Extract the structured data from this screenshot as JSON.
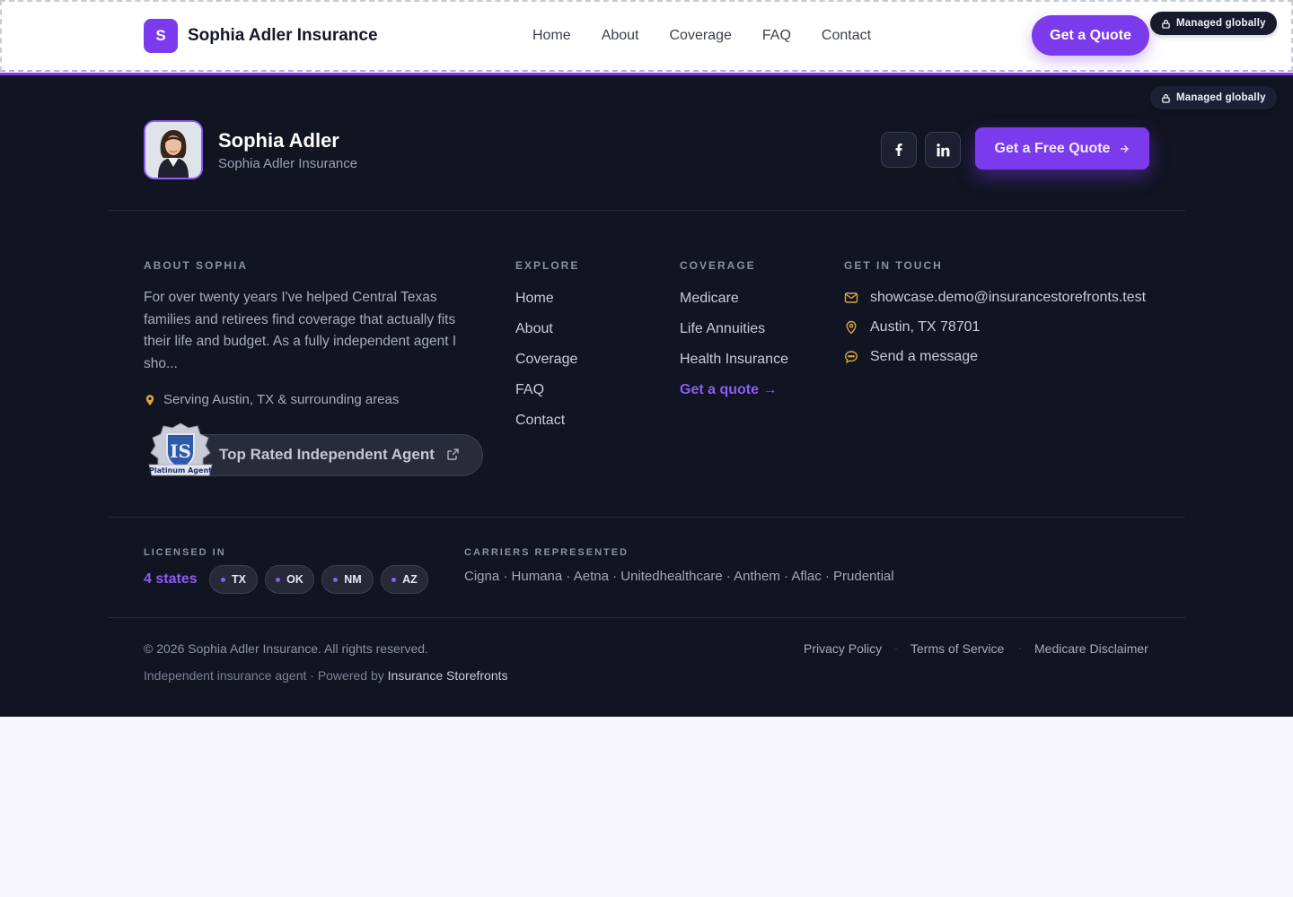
{
  "header": {
    "brand_initial": "S",
    "brand_name": "Sophia Adler Insurance",
    "nav": [
      "Home",
      "About",
      "Coverage",
      "FAQ",
      "Contact"
    ],
    "cta_label": "Get a Quote"
  },
  "badges": {
    "managed_label": "Managed globally"
  },
  "agent": {
    "name": "Sophia Adler",
    "company": "Sophia Adler Insurance",
    "cta_label": "Get a Free Quote",
    "social": [
      "facebook-icon",
      "linkedin-icon"
    ]
  },
  "about": {
    "title": "About Sophia",
    "text": "For over twenty years I've helped Central Texas families and retirees find coverage that actually fits their life and budget. As a fully independent agent I sho...",
    "serving": "Serving Austin, TX & surrounding areas",
    "rated_label": "Top Rated Independent Agent",
    "seal_top": "IS",
    "seal_banner": "Platinum Agent"
  },
  "explore": {
    "title": "Explore",
    "links": [
      "Home",
      "About",
      "Coverage",
      "FAQ",
      "Contact"
    ]
  },
  "coverage": {
    "title": "Coverage",
    "links": [
      "Medicare",
      "Life Annuities",
      "Health Insurance"
    ],
    "quote_link": "Get a quote →"
  },
  "contact": {
    "title": "Get in touch",
    "email": "showcase.demo@insurancestorefronts.test",
    "location": "Austin, TX 78701",
    "message": "Send a message"
  },
  "licensed": {
    "title": "Licensed in",
    "count": "4 states",
    "states": [
      "TX",
      "OK",
      "NM",
      "AZ"
    ]
  },
  "carriers": {
    "title": "Carriers represented",
    "list": "Cigna · Humana · Aetna · Unitedhealthcare · Anthem · Aflac · Prudential"
  },
  "bottom": {
    "copyright": "© 2026 Sophia Adler Insurance. All rights reserved.",
    "powered_prefix": "Independent insurance agent · Powered by",
    "powered_brand": "Insurance Storefronts",
    "legal": [
      "Privacy Policy",
      "Terms of Service",
      "Medicare Disclaimer"
    ]
  },
  "colors": {
    "accent": "#7c3aed",
    "footer_bg": "#111421",
    "gold": "#d9a640"
  }
}
